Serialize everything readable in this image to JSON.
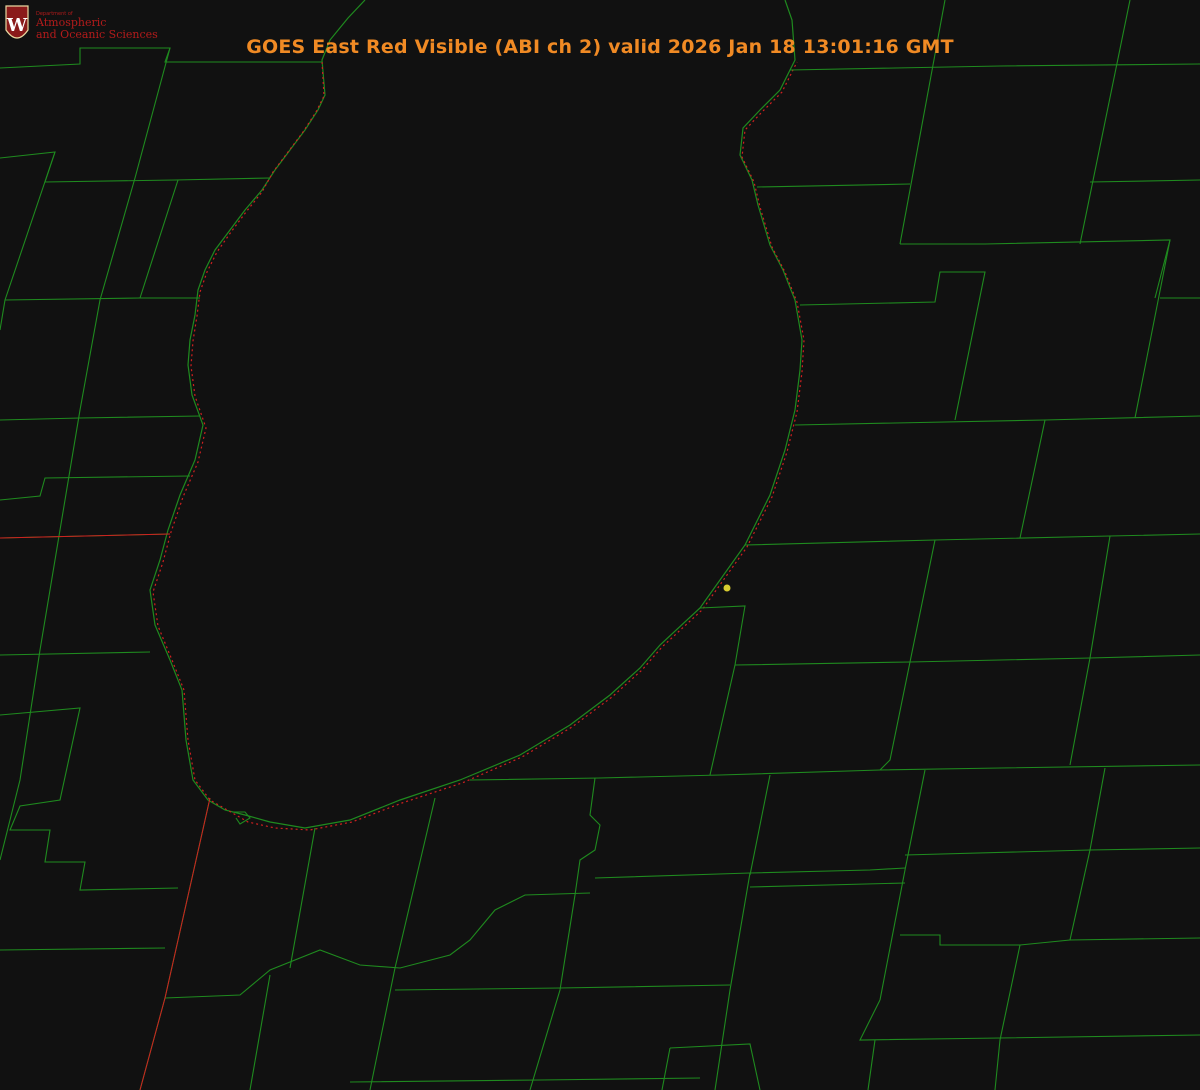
{
  "title": "GOES East Red Visible (ABI ch 2) valid 2026 Jan 18 13:01:16 GMT",
  "logo": {
    "emblem_letter": "W",
    "small_text": "Department of",
    "line1": "Atmospheric",
    "line2": "and Oceanic Sciences"
  },
  "colors": {
    "background": "#111111",
    "title": "#f08a24",
    "boundaries": "#1f8a1f",
    "coastline_dotted": "#d02020",
    "marker": "#d8cc30",
    "logo_text": "#b31b1b",
    "logo_crest": "#8a1a1a"
  },
  "icons": {
    "marker": "location-dot-icon",
    "emblem": "uw-crest-icon"
  }
}
